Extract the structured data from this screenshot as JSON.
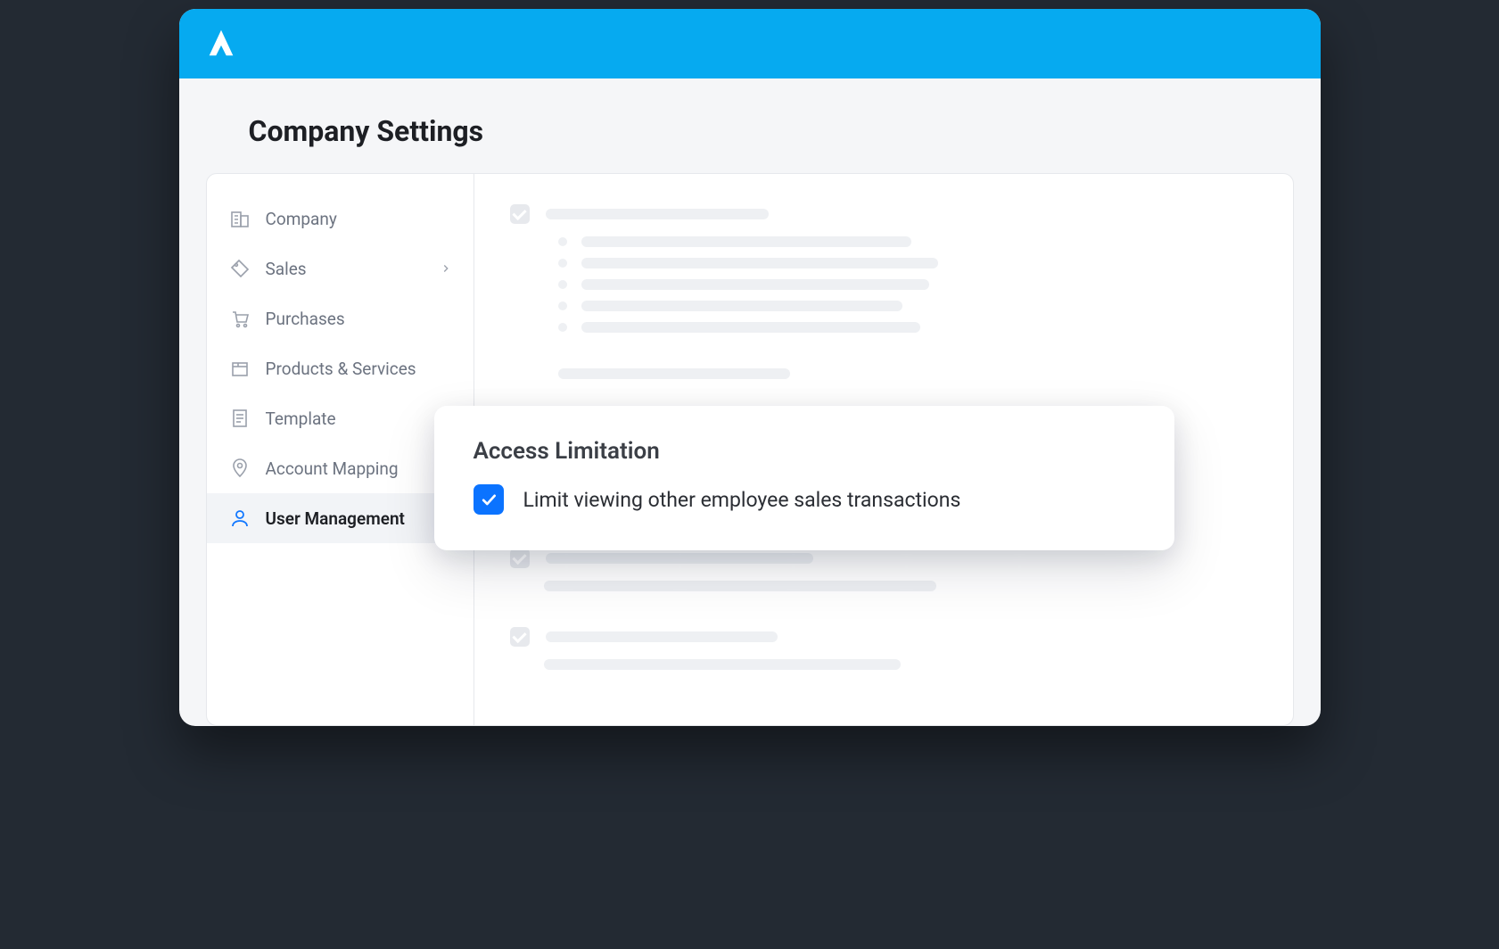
{
  "page": {
    "title": "Company Settings"
  },
  "sidebar": {
    "items": [
      {
        "label": "Company",
        "icon": "building-icon"
      },
      {
        "label": "Sales",
        "icon": "tag-icon",
        "hasSubmenu": true
      },
      {
        "label": "Purchases",
        "icon": "cart-icon"
      },
      {
        "label": "Products & Services",
        "icon": "box-icon"
      },
      {
        "label": "Template",
        "icon": "document-icon"
      },
      {
        "label": "Account Mapping",
        "icon": "map-pin-icon"
      },
      {
        "label": "User Management",
        "icon": "user-icon",
        "active": true
      }
    ]
  },
  "popover": {
    "title": "Access Limitation",
    "checkbox_label": "Limit viewing other employee sales transactions",
    "checked": true
  },
  "colors": {
    "brand": "#06aaf0",
    "accent": "#0b73ff"
  }
}
